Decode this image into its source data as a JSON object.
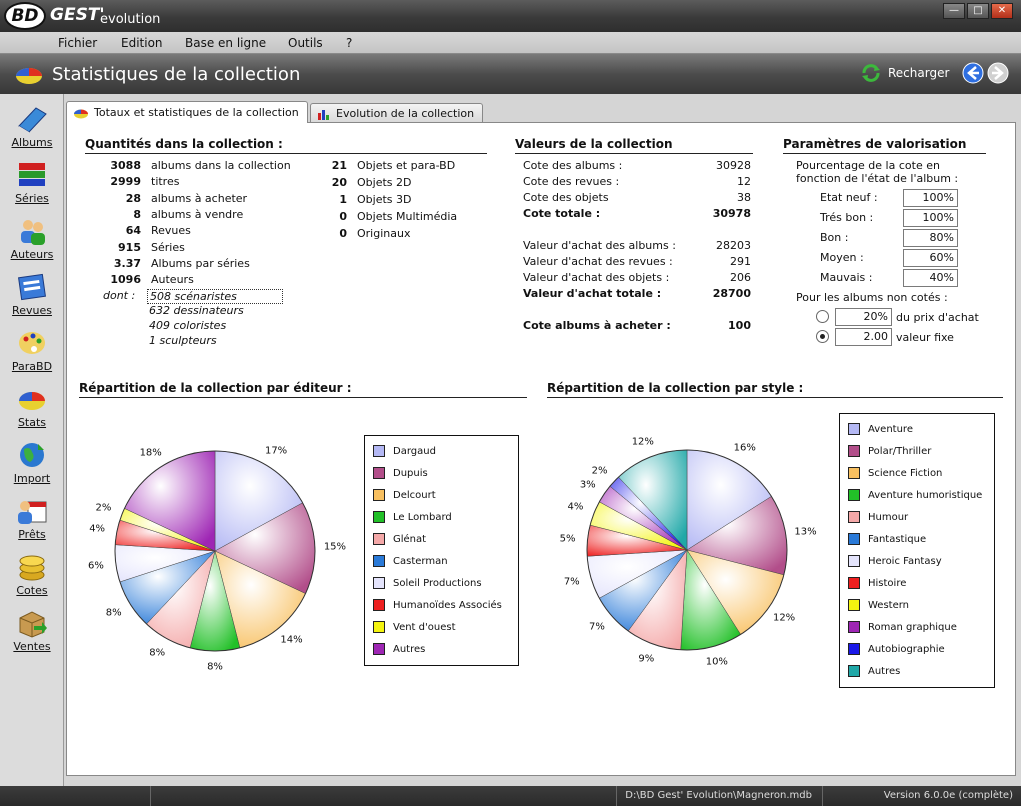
{
  "app": {
    "logo_bd": "BD",
    "logo_gest": "GEST'",
    "logo_evolution": "evolution"
  },
  "menu": [
    "Fichier",
    "Edition",
    "Base en ligne",
    "Outils",
    "?"
  ],
  "header": {
    "title": "Statistiques de la collection",
    "reload_label": "Recharger"
  },
  "sidebar": [
    "Albums",
    "Séries",
    "Auteurs",
    "Revues",
    "ParaBD",
    "Stats",
    "Import",
    "Prêts",
    "Cotes",
    "Ventes"
  ],
  "tabs": [
    "Totaux et statistiques de la collection",
    "Evolution de la collection"
  ],
  "quantities": {
    "title": "Quantités dans la collection :",
    "rows": [
      {
        "n": "3088",
        "label": "albums dans la collection"
      },
      {
        "n": "2999",
        "label": "titres"
      },
      {
        "n": "28",
        "label": "albums à acheter"
      },
      {
        "n": "8",
        "label": "albums à vendre"
      },
      {
        "n": "64",
        "label": "Revues"
      },
      {
        "n": "915",
        "label": "Séries"
      },
      {
        "n": "3.37",
        "label": "Albums par séries"
      },
      {
        "n": "1096",
        "label": "Auteurs"
      }
    ],
    "dont": "dont :",
    "authors": [
      "508 scénaristes",
      "632 dessinateurs",
      "409 coloristes",
      "1 sculpteurs"
    ],
    "objects": [
      {
        "n": "21",
        "label": "Objets et para-BD"
      },
      {
        "n": "20",
        "label": "Objets 2D"
      },
      {
        "n": "1",
        "label": "Objets 3D"
      },
      {
        "n": "0",
        "label": "Objets Multimédia"
      },
      {
        "n": "0",
        "label": "Originaux"
      }
    ]
  },
  "values": {
    "title": "Valeurs de la collection",
    "rows": [
      {
        "label": "Cote des albums :",
        "v": "30928",
        "bold": false
      },
      {
        "label": "Cote des revues :",
        "v": "12",
        "bold": false
      },
      {
        "label": "Cote des objets",
        "v": "38",
        "bold": false
      },
      {
        "label": "Cote totale :",
        "v": "30978",
        "bold": true
      },
      {
        "label": "Valeur d'achat des albums :",
        "v": "28203",
        "bold": false
      },
      {
        "label": "Valeur d'achat des revues :",
        "v": "291",
        "bold": false
      },
      {
        "label": "Valeur d'achat des objets :",
        "v": "206",
        "bold": false
      },
      {
        "label": "Valeur d'achat totale :",
        "v": "28700",
        "bold": true
      },
      {
        "label": "Cote albums à acheter :",
        "v": "100",
        "bold": true
      }
    ]
  },
  "params": {
    "title": "Paramètres de valorisation",
    "desc1": "Pourcentage de la cote en",
    "desc2": "fonction de l'état de l'album :",
    "states": [
      {
        "label": "Etat neuf :",
        "v": "100%"
      },
      {
        "label": "Trés bon :",
        "v": "100%"
      },
      {
        "label": "Bon :",
        "v": "80%"
      },
      {
        "label": "Moyen :",
        "v": "60%"
      },
      {
        "label": "Mauvais :",
        "v": "40%"
      }
    ],
    "noncote": "Pour les albums non cotés :",
    "opt1_value": "20%",
    "opt1_label": "du prix d'achat",
    "opt2_value": "2.00",
    "opt2_label": "valeur fixe",
    "selected": 2
  },
  "chart_data": [
    {
      "type": "pie",
      "title": "Répartition de la collection par éditeur :",
      "labels": [
        "Dargaud",
        "Dupuis",
        "Delcourt",
        "Le Lombard",
        "Glénat",
        "Casterman",
        "Soleil Productions",
        "Humanoïdes Associés",
        "Vent d'ouest",
        "Autres"
      ],
      "values": [
        17,
        15,
        14,
        8,
        8,
        8,
        6,
        4,
        2,
        18
      ],
      "colors": [
        "#b4b8f4",
        "#b24e8a",
        "#f8c060",
        "#22c028",
        "#f4a8a8",
        "#2a7ad8",
        "#e4e4fc",
        "#ee2020",
        "#f4f410",
        "#9e26b4"
      ]
    },
    {
      "type": "pie",
      "title": "Répartition de la collection par style :",
      "labels": [
        "Aventure",
        "Polar/Thriller",
        "Science Fiction",
        "Aventure humoristique",
        "Humour",
        "Fantastique",
        "Heroic Fantasy",
        "Histoire",
        "Western",
        "Roman graphique",
        "Autobiographie",
        "Autres"
      ],
      "values": [
        16,
        13,
        12,
        10,
        9,
        7,
        7,
        5,
        4,
        3,
        2,
        12
      ],
      "colors": [
        "#b4b8f4",
        "#b24e8a",
        "#f8c060",
        "#22c028",
        "#f4a8a8",
        "#2a7ad8",
        "#e4e4fc",
        "#ee2020",
        "#f4f410",
        "#9e26b4",
        "#1a18e8",
        "#20a8a8"
      ]
    }
  ],
  "status": {
    "path": "D:\\BD Gest' Evolution\\Magneron.mdb",
    "version": "Version 6.0.0e (complète)"
  }
}
